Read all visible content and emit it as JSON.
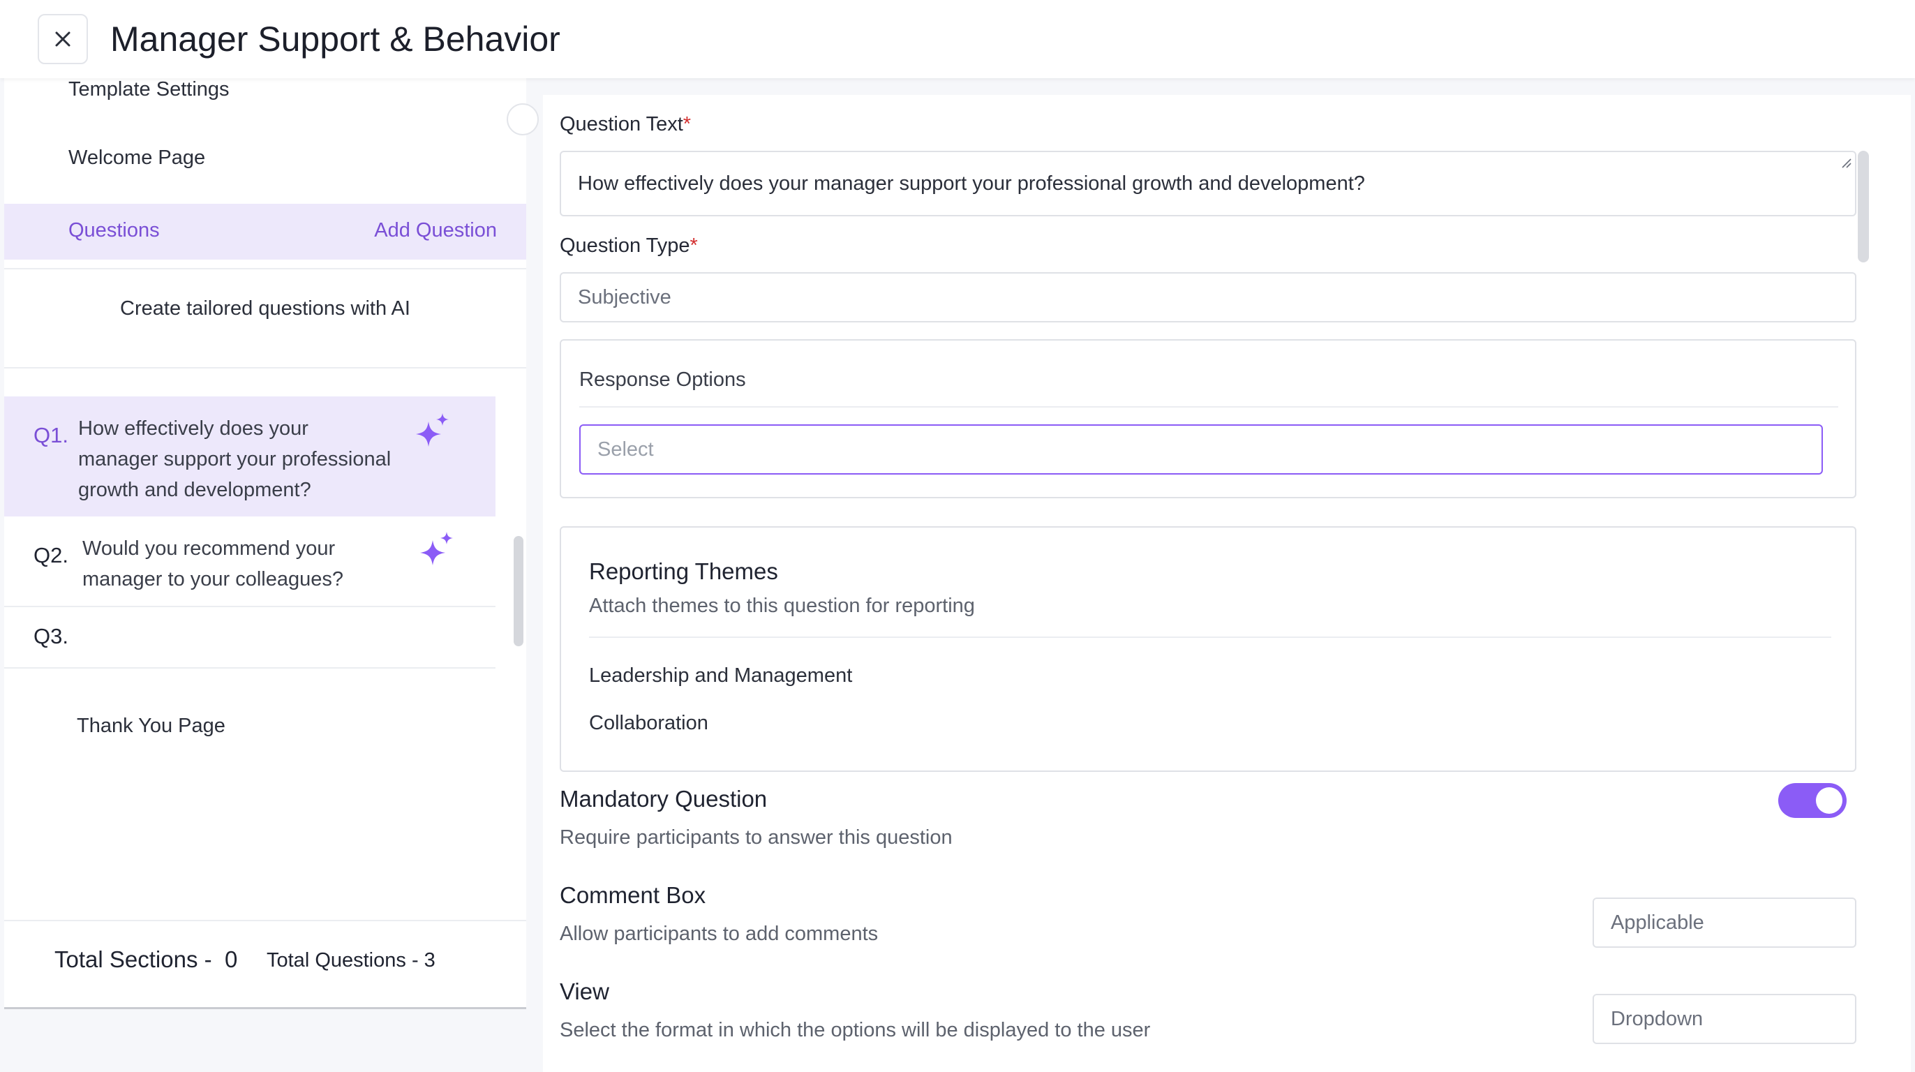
{
  "header": {
    "title": "Manager Support & Behavior",
    "close_icon": "close-icon"
  },
  "sidebar": {
    "template_settings": "Template Settings",
    "welcome_page": "Welcome Page",
    "questions_label": "Questions",
    "add_question": "Add Question",
    "ai_link": "Create tailored questions with AI",
    "questions": [
      {
        "num": "Q1.",
        "lines": [
          "How effectively does your",
          "manager support your professional",
          "growth and development?"
        ],
        "active": true
      },
      {
        "num": "Q2.",
        "lines": [
          "Would you recommend your",
          "manager to your colleagues?"
        ],
        "active": false
      },
      {
        "num": "Q3.",
        "lines": [],
        "active": false
      }
    ],
    "thank_you": "Thank You Page",
    "total_sections_label": "Total Sections -",
    "total_sections_value": "0",
    "total_questions_label": "Total Questions",
    "total_questions_value": "- 3"
  },
  "form": {
    "question_text_label": "Question Text",
    "question_text_value": "How effectively does your manager support your professional growth and development?",
    "question_type_label": "Question Type",
    "question_type_value": "Subjective",
    "required_mark": "*",
    "response_options_label": "Response Options",
    "response_options_placeholder": "Select",
    "reporting_themes_title": "Reporting Themes",
    "reporting_themes_desc": "Attach themes to this question for reporting",
    "themes": [
      "Leadership and Management",
      "Collaboration"
    ],
    "mandatory_title": "Mandatory Question",
    "mandatory_desc": "Require participants to answer this question",
    "mandatory_on": true,
    "comment_title": "Comment Box",
    "comment_desc": "Allow participants to add comments",
    "comment_value": "Applicable",
    "view_title": "View",
    "view_desc": "Select the format in which the options will be displayed to the user",
    "view_value": "Dropdown"
  },
  "colors": {
    "accent": "#8b5cf6",
    "accent_text": "#7a4fd6",
    "active_bg": "#ede8fb",
    "required": "#d32f2f"
  }
}
